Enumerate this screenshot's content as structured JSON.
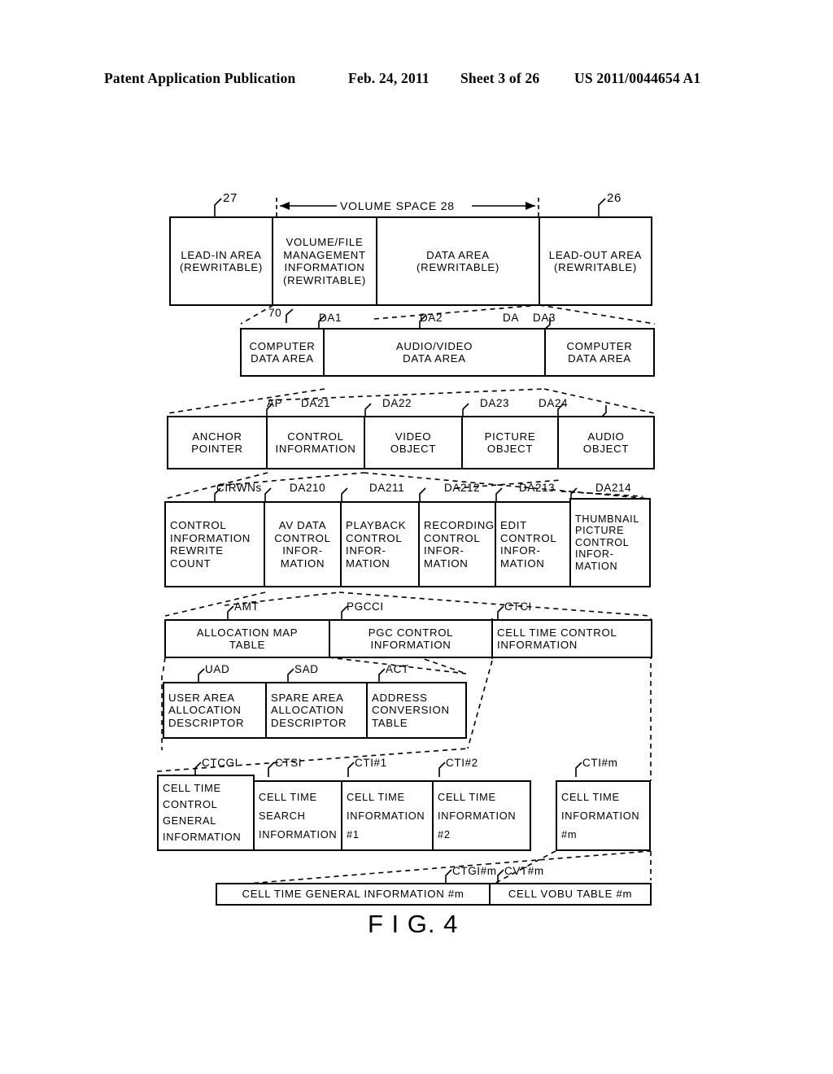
{
  "header": {
    "publication": "Patent Application Publication",
    "date": "Feb. 24, 2011",
    "sheet": "Sheet 3 of 26",
    "number": "US 2011/0044654 A1"
  },
  "figure": {
    "caption": "F I G. 4",
    "volume_space_label": "VOLUME SPACE 28"
  },
  "rows": {
    "row1": {
      "refs": {
        "left": "27",
        "right": "26"
      },
      "cells": [
        {
          "lines": [
            "LEAD-IN AREA",
            "(REWRITABLE)"
          ]
        },
        {
          "lines": [
            "VOLUME/FILE",
            "MANAGEMENT",
            "INFORMATION",
            "(REWRITABLE)"
          ]
        },
        {
          "lines": [
            "DATA AREA",
            "(REWRITABLE)"
          ]
        },
        {
          "lines": [
            "LEAD-OUT AREA",
            "(REWRITABLE)"
          ]
        }
      ]
    },
    "row2": {
      "refs": {
        "r70": "70",
        "da1": "DA1",
        "da2": "DA2",
        "da": "DA",
        "da3": "DA3"
      },
      "cells": [
        {
          "lines": [
            "COMPUTER",
            "DATA AREA"
          ]
        },
        {
          "lines": [
            "AUDIO/VIDEO",
            "DATA AREA"
          ]
        },
        {
          "lines": [
            "COMPUTER",
            "DATA AREA"
          ]
        }
      ]
    },
    "row3": {
      "refs": {
        "ap": "AP",
        "da21": "DA21",
        "da22": "DA22",
        "da23": "DA23",
        "da24": "DA24"
      },
      "cells": [
        {
          "lines": [
            "ANCHOR",
            "POINTER"
          ]
        },
        {
          "lines": [
            "CONTROL",
            "INFORMATION"
          ]
        },
        {
          "lines": [
            "VIDEO",
            "OBJECT"
          ]
        },
        {
          "lines": [
            "PICTURE",
            "OBJECT"
          ]
        },
        {
          "lines": [
            "AUDIO",
            "OBJECT"
          ]
        }
      ]
    },
    "row4": {
      "refs": {
        "cirwns": "CIRWNs",
        "da210": "DA210",
        "da211": "DA211",
        "da212": "DA212",
        "da213": "DA213",
        "da214": "DA214"
      },
      "cells": [
        {
          "lines": [
            "CONTROL",
            "INFORMATION",
            "REWRITE",
            "COUNT"
          ]
        },
        {
          "lines": [
            "AV DATA",
            "CONTROL",
            "INFOR-",
            "MATION"
          ]
        },
        {
          "lines": [
            "PLAYBACK",
            "CONTROL",
            "INFOR-",
            "MATION"
          ]
        },
        {
          "lines": [
            "RECORDING",
            "CONTROL",
            "INFOR-",
            "MATION"
          ]
        },
        {
          "lines": [
            "EDIT",
            "CONTROL",
            "INFOR-",
            "MATION"
          ]
        },
        {
          "lines": [
            "THUMBNAIL",
            "PICTURE",
            "CONTROL",
            "INFOR-",
            "MATION"
          ]
        }
      ]
    },
    "row5": {
      "refs": {
        "amt": "AMT",
        "pgcci": "PGCCI",
        "ctci": "CTCI"
      },
      "cells": [
        {
          "lines": [
            "ALLOCATION MAP",
            "TABLE"
          ]
        },
        {
          "lines": [
            "PGC CONTROL",
            "INFORMATION"
          ]
        },
        {
          "lines": [
            "CELL TIME CONTROL",
            "INFORMATION"
          ]
        }
      ]
    },
    "row6": {
      "refs": {
        "uad": "UAD",
        "sad": "SAD",
        "act": "ACT"
      },
      "cells": [
        {
          "lines": [
            "USER AREA",
            "ALLOCATION",
            "DESCRIPTOR"
          ]
        },
        {
          "lines": [
            "SPARE AREA",
            "ALLOCATION",
            "DESCRIPTOR"
          ]
        },
        {
          "lines": [
            "ADDRESS",
            "CONVERSION",
            "TABLE"
          ]
        }
      ]
    },
    "row7": {
      "refs": {
        "ctcgi": "CTCGI",
        "ctsi": "CTSI",
        "cti1": "CTI#1",
        "cti2": "CTI#2",
        "ctim": "CTI#m"
      },
      "cells": [
        {
          "lines": [
            "CELL TIME",
            "CONTROL",
            "GENERAL",
            "INFORMATION"
          ]
        },
        {
          "lines": [
            "CELL TIME",
            "SEARCH",
            "INFORMATION"
          ]
        },
        {
          "lines": [
            "CELL TIME",
            "INFORMATION",
            "#1"
          ]
        },
        {
          "lines": [
            "CELL TIME",
            "INFORMATION",
            "#2"
          ]
        },
        {
          "lines": [
            "CELL TIME",
            "INFORMATION",
            "#m"
          ]
        }
      ]
    },
    "row8": {
      "refs": {
        "ctgim": "CTGI#m",
        "cvtm": "CVT#m"
      },
      "cells": [
        {
          "lines": [
            "CELL TIME GENERAL INFORMATION #m"
          ]
        },
        {
          "lines": [
            "CELL VOBU TABLE #m"
          ]
        }
      ]
    }
  }
}
